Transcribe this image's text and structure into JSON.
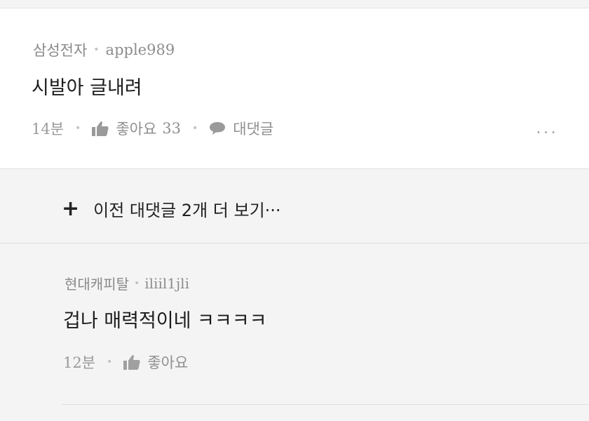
{
  "comment": {
    "company": "삼성전자",
    "user": "apple989",
    "text": "시발아 글내려",
    "time": "14분",
    "like_label": "좋아요",
    "like_count": "33",
    "reply_label": "대댓글",
    "more": "···"
  },
  "load_previous": {
    "icon": "+",
    "label": "이전 대댓글 2개 더 보기···"
  },
  "reply": {
    "company": "현대캐피탈",
    "user": "iliil1jli",
    "text": "겁나 매력적이네 ㅋㅋㅋㅋ",
    "time": "12분",
    "like_label": "좋아요"
  },
  "icons": {
    "separator": "•",
    "like": "thumbs-up-icon",
    "reply": "speech-bubble-icon"
  }
}
